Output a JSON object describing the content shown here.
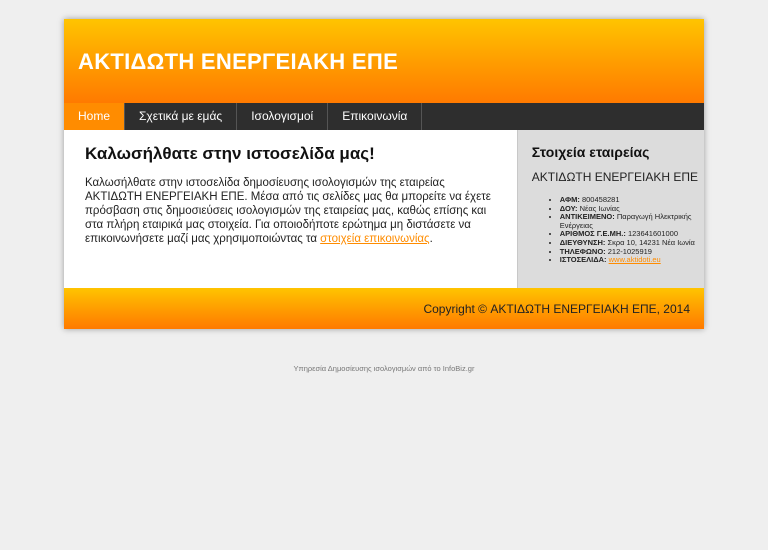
{
  "header": {
    "title": "ΑΚΤΙΔΩΤΗ ΕΝΕΡΓΕΙΑΚΗ ΕΠΕ"
  },
  "nav": [
    {
      "label": "Home",
      "active": true
    },
    {
      "label": "Σχετικά με εμάς"
    },
    {
      "label": "Ισολογισμοί"
    },
    {
      "label": "Επικοινωνία"
    }
  ],
  "main": {
    "heading": "Καλωσήλθατε στην ιστοσελίδα μας!",
    "intro_text": "Καλωσήλθατε στην ιστοσελίδα δημοσίευσης ισολογισμών της εταιρείας ΑΚΤΙΔΩΤΗ ΕΝΕΡΓΕΙΑΚΗ ΕΠΕ. Μέσα από τις σελίδες μας θα μπορείτε να έχετε πρόσβαση στις δημοσιεύσεις ισολογισμών της εταιρείας μας, καθώς επίσης και στα πλήρη εταιρικά μας στοιχεία. Για οποιοδήποτε ερώτημα μη διστάσετε να επικοινωνήσετε μαζί μας χρησιμοποιώντας τα ",
    "contact_link": "στοιχεία επικοινωνίας",
    "end": "."
  },
  "sidebar": {
    "title": "Στοιχεία εταιρείας",
    "company": "ΑΚΤΙΔΩΤΗ ΕΝΕΡΓΕΙΑΚΗ ΕΠΕ",
    "details": [
      {
        "label": "ΑΦΜ:",
        "value": " 800458281"
      },
      {
        "label": "ΔΟΥ:",
        "value": " Νέας Ιωνίας"
      },
      {
        "label": "ΑΝΤΙΚΕΙΜΕΝΟ:",
        "value": " Παραγωγή Ηλεκτρικής Ενέργειας"
      },
      {
        "label": "ΑΡΙΘΜΟΣ Γ.Ε.ΜΗ.:",
        "value": " 123641601000"
      },
      {
        "label": "ΔΙΕΥΘΥΝΣΗ:",
        "value": " Σκρα 10, 14231 Νέα Ιωνία"
      },
      {
        "label": "ΤΗΛΕΦΩΝΟ:",
        "value": " 212-1025919"
      }
    ],
    "website_label": "ΙΣΤΟΣΕΛΙΔΑ:",
    "website": "www.aktidoti.eu"
  },
  "footer": {
    "copyright": "Copyright © ΑΚΤΙΔΩΤΗ ΕΝΕΡΓΕΙΑΚΗ ΕΠΕ, 2014"
  },
  "credit": "Υπηρεσία Δημοσίευσης ισολογισμών από το InfoBiz.gr"
}
